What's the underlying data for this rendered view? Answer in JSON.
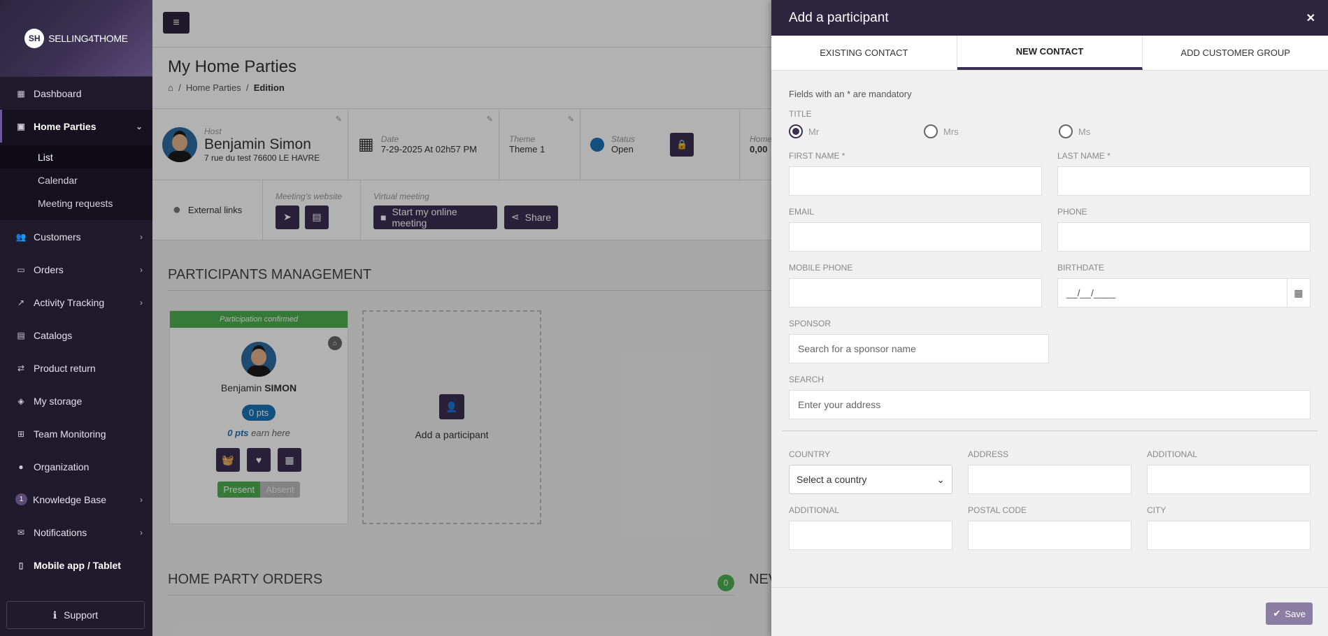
{
  "brand": {
    "logo_initials": "SH",
    "logo_text": "SELLING4THOME"
  },
  "sidebar": {
    "items": [
      {
        "label": "Dashboard",
        "icon": "dashboard-icon"
      },
      {
        "label": "Home Parties",
        "icon": "calendar-icon"
      },
      {
        "label": "Customers",
        "icon": "users-icon"
      },
      {
        "label": "Orders",
        "icon": "credit-card-icon"
      },
      {
        "label": "Activity Tracking",
        "icon": "chart-icon"
      },
      {
        "label": "Catalogs",
        "icon": "book-icon"
      },
      {
        "label": "Product return",
        "icon": "exchange-icon"
      },
      {
        "label": "My storage",
        "icon": "cube-icon"
      },
      {
        "label": "Team Monitoring",
        "icon": "sitemap-icon"
      },
      {
        "label": "Organization",
        "icon": "globe-icon"
      },
      {
        "label": "Knowledge Base",
        "icon": "badge",
        "badge": "1"
      },
      {
        "label": "Notifications",
        "icon": "envelope-icon"
      },
      {
        "label": "Mobile app / Tablet",
        "icon": "mobile-icon"
      }
    ],
    "sub_items": [
      "List",
      "Calendar",
      "Meeting requests"
    ],
    "support": "Support"
  },
  "page": {
    "title": "My Home Parties",
    "breadcrumb": [
      "Home Parties",
      "Edition"
    ],
    "host_label": "Host",
    "host_name": "Benjamin Simon",
    "host_address": "7 rue du test 76600 LE HAVRE",
    "date_label": "Date",
    "date_value": "7-29-2025 At 02h57 PM",
    "theme_label": "Theme",
    "theme_value": "Theme 1",
    "status_label": "Status",
    "status_value": "Open",
    "home_label": "Home",
    "home_value": "0,00",
    "external_links": "External links",
    "website_label": "Meeting's website",
    "virtual_label": "Virtual meeting",
    "start_meeting": "Start my online meeting",
    "share": "Share",
    "participants_title": "PARTICIPANTS MANAGEMENT",
    "participant": {
      "confirmed": "Participation confirmed",
      "first": "Benjamin",
      "last": "SIMON",
      "pts": "0 pts",
      "earn_pts": "0 pts",
      "earn_text": "earn here",
      "present": "Present",
      "absent": "Absent"
    },
    "add_participant": "Add a participant",
    "orders_title": "HOME PARTY ORDERS",
    "orders_count": "0",
    "new_title": "NEV"
  },
  "panel": {
    "title": "Add a participant",
    "tabs": [
      "EXISTING CONTACT",
      "NEW CONTACT",
      "ADD CUSTOMER GROUP"
    ],
    "mandatory_note": "Fields with an * are mandatory",
    "title_label": "TITLE",
    "title_options": [
      "Mr",
      "Mrs",
      "Ms"
    ],
    "first_name": "FIRST NAME *",
    "last_name": "LAST NAME *",
    "email": "EMAIL",
    "phone": "PHONE",
    "mobile": "MOBILE PHONE",
    "birthdate": "BIRTHDATE",
    "birthdate_value": "__/__/____",
    "sponsor": "SPONSOR",
    "sponsor_placeholder": "Search for a sponsor name",
    "search": "SEARCH",
    "search_placeholder": "Enter your address",
    "country": "COUNTRY",
    "country_value": "Select a country",
    "address": "ADDRESS",
    "additional": "ADDITIONAL",
    "additional2": "ADDITIONAL",
    "postal": "POSTAL CODE",
    "city": "CITY",
    "save": "Save"
  }
}
